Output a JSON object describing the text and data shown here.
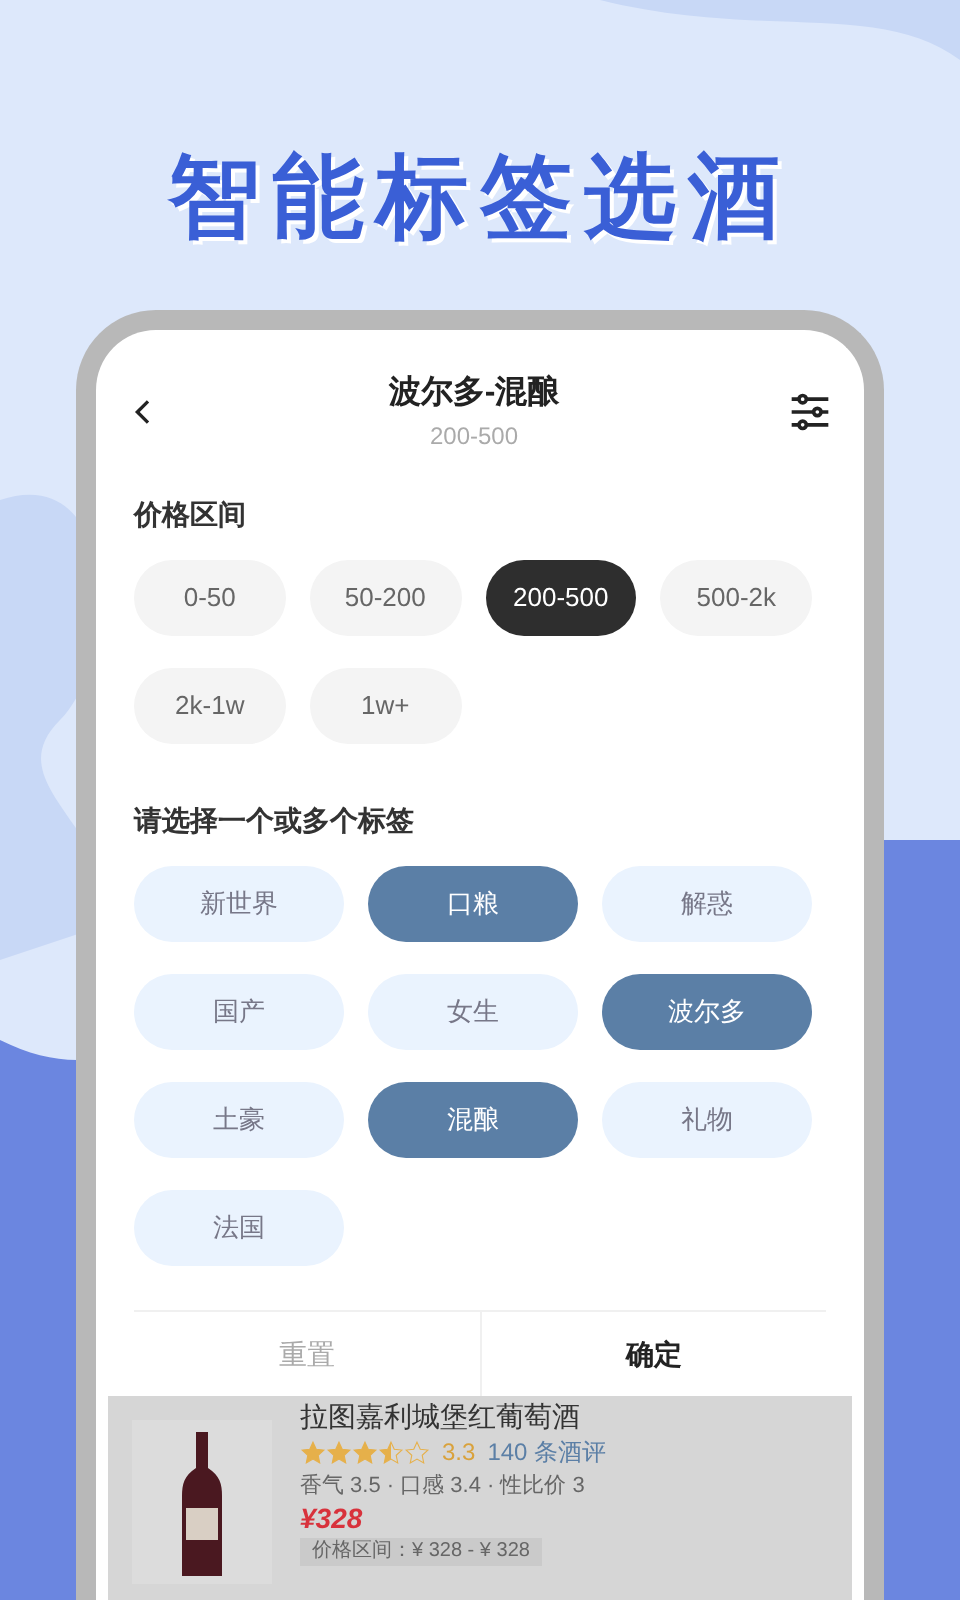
{
  "headline": "智能标签选酒",
  "header": {
    "title": "波尔多-混酿",
    "subtitle": "200-500"
  },
  "price_section": {
    "label": "价格区间",
    "options": [
      {
        "label": "0-50",
        "selected": false
      },
      {
        "label": "50-200",
        "selected": false
      },
      {
        "label": "200-500",
        "selected": true
      },
      {
        "label": "500-2k",
        "selected": false
      },
      {
        "label": "2k-1w",
        "selected": false
      },
      {
        "label": "1w+",
        "selected": false
      }
    ]
  },
  "tag_section": {
    "label": "请选择一个或多个标签",
    "tags": [
      {
        "label": "新世界",
        "selected": false
      },
      {
        "label": "口粮",
        "selected": true
      },
      {
        "label": "解惑",
        "selected": false
      },
      {
        "label": "国产",
        "selected": false
      },
      {
        "label": "女生",
        "selected": false
      },
      {
        "label": "波尔多",
        "selected": true
      },
      {
        "label": "土豪",
        "selected": false
      },
      {
        "label": "混酿",
        "selected": true
      },
      {
        "label": "礼物",
        "selected": false
      },
      {
        "label": "法国",
        "selected": false
      }
    ]
  },
  "actions": {
    "reset": "重置",
    "confirm": "确定"
  },
  "product": {
    "name": "拉图嘉利城堡红葡萄酒",
    "stars": 3.5,
    "rating": "3.3",
    "reviews": "140 条酒评",
    "scores": "香气 3.5 · 口感 3.4 · 性比价 3",
    "price": "¥328",
    "price_range": "价格区间：¥ 328 - ¥ 328"
  }
}
